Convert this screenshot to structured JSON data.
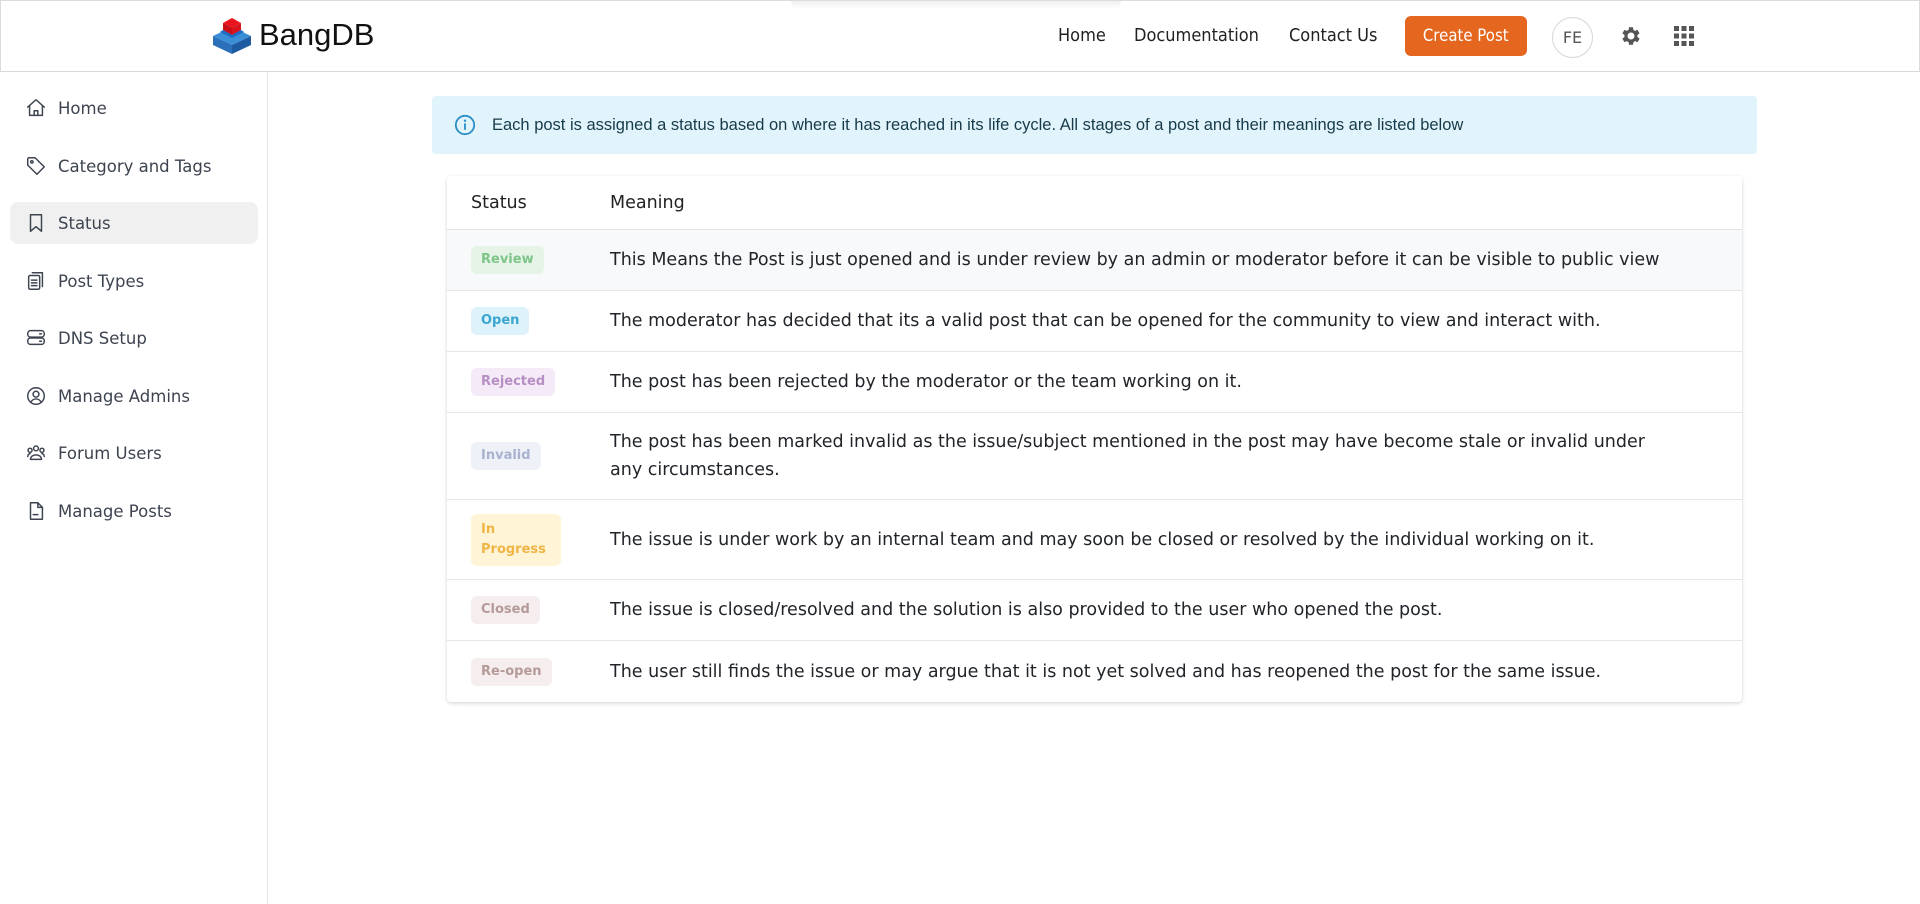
{
  "header": {
    "brand": "BangDB",
    "nav": [
      {
        "label": "Home"
      },
      {
        "label": "Documentation"
      },
      {
        "label": "Contact Us"
      }
    ],
    "create_post_label": "Create Post",
    "avatar_initials": "FE",
    "icons": [
      "gear-icon",
      "apps-grid-icon"
    ],
    "accent_color": "#e5661e"
  },
  "sidebar": {
    "active": "Status",
    "items": [
      {
        "label": "Home",
        "icon": "home-icon"
      },
      {
        "label": "Category and Tags",
        "icon": "tag-icon"
      },
      {
        "label": "Status",
        "icon": "bookmark-icon"
      },
      {
        "label": "Post Types",
        "icon": "clipboard-list-icon"
      },
      {
        "label": "DNS Setup",
        "icon": "server-icon"
      },
      {
        "label": "Manage Admins",
        "icon": "user-circle-icon"
      },
      {
        "label": "Forum Users",
        "icon": "users-icon"
      },
      {
        "label": "Manage Posts",
        "icon": "file-icon"
      }
    ]
  },
  "banner": {
    "icon": "info-icon",
    "text": "Each post is assigned a status based on where it has reached in its life cycle. All stages of a post and their meanings are listed below"
  },
  "table": {
    "columns": [
      "Status",
      "Meaning"
    ],
    "rows": [
      {
        "status": "Review",
        "meaning": "This Means the Post is just opened and is under review by an admin or moderator before it can be visible to public view",
        "color": "#7cc487",
        "bg": "#e5f4e6"
      },
      {
        "status": "Open",
        "meaning": "The moderator has decided that its a valid post that can be opened for the community to view and interact with.",
        "color": "#3aa6cf",
        "bg": "#ddf2fa"
      },
      {
        "status": "Rejected",
        "meaning": "The post has been rejected by the moderator or the team working on it.",
        "color": "#b68fc4",
        "bg": "#f5eaf7"
      },
      {
        "status": "Invalid",
        "meaning": "The post has been marked invalid as the issue/subject mentioned in the post may have become stale or invalid under any circumstances.",
        "color": "#a9b3cf",
        "bg": "#eff1f8"
      },
      {
        "status": "In Progress",
        "meaning": "The issue is under work by an internal team and may soon be closed or resolved by the individual working on it.",
        "color": "#f0b545",
        "bg": "#fff4d6"
      },
      {
        "status": "Closed",
        "meaning": "The issue is closed/resolved and the solution is also provided to the user who opened the post.",
        "color": "#b49a98",
        "bg": "#f6eeee"
      },
      {
        "status": "Re-open",
        "meaning": "The user still finds the issue or may argue that it is not yet solved and has reopened the post for the same issue.",
        "color": "#b49a98",
        "bg": "#f6eeee"
      }
    ]
  }
}
